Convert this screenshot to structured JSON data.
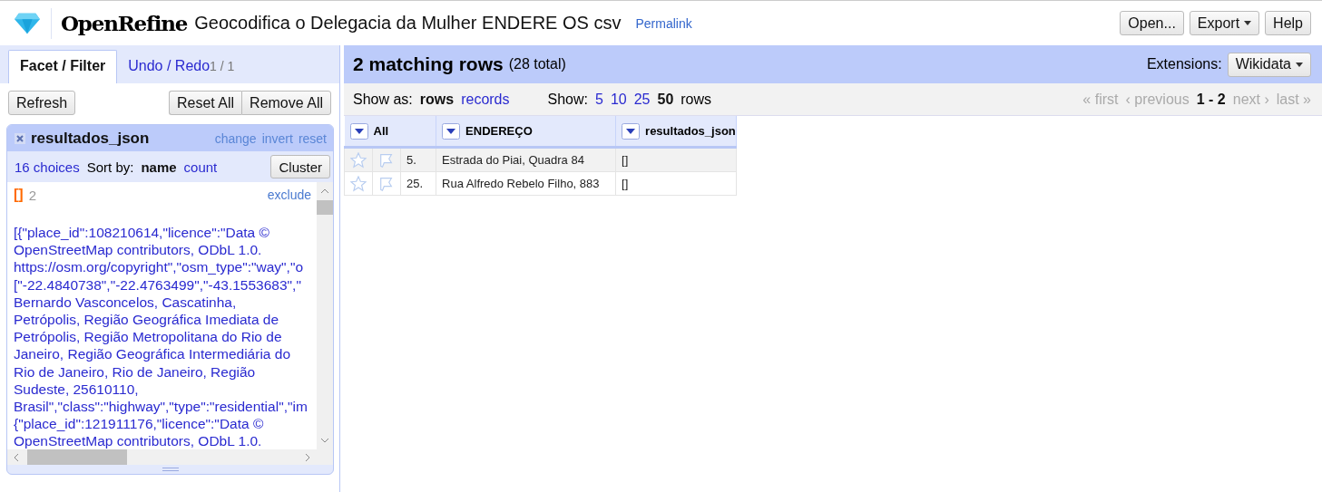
{
  "app": {
    "name": "OpenRefine",
    "project_title": "Geocodifica o Delegacia da Mulher ENDERE OS csv",
    "permalink": "Permalink"
  },
  "header_buttons": [
    {
      "label": "Open...",
      "dropdown": false
    },
    {
      "label": "Export",
      "dropdown": true
    },
    {
      "label": "Help",
      "dropdown": false
    }
  ],
  "left_tabs": [
    {
      "label": "Facet / Filter",
      "selected": true
    },
    {
      "label": "Undo / Redo",
      "count": "1 / 1",
      "selected": false
    }
  ],
  "facet_toolbar": {
    "refresh": "Refresh",
    "reset_all": "Reset All",
    "remove_all": "Remove All"
  },
  "facet": {
    "title": "resultados_json",
    "links": [
      "change",
      "invert",
      "reset"
    ],
    "choices_count": "16 choices",
    "sort_label": "Sort by:",
    "sort_options": [
      {
        "label": "name",
        "selected": true
      },
      {
        "label": "count",
        "selected": false
      }
    ],
    "cluster": "Cluster",
    "choices": [
      {
        "label": "[]",
        "count": "2",
        "selected": true,
        "action": "exclude"
      },
      {
        "selected": false,
        "lines": [
          "[{\"place_id\":108210614,\"licence\":\"Data ©",
          "OpenStreetMap contributors, ODbL 1.0.",
          "https://osm.org/copyright\",\"osm_type\":\"way\",\"o",
          "[\"-22.4840738\",\"-22.4763499\",\"-43.1553683\",\"",
          "Bernardo Vasconcelos, Cascatinha,",
          "Petrópolis, Região Geográfica Imediata de",
          "Petrópolis, Região Metropolitana do Rio de",
          "Janeiro, Região Geográfica Intermediária do",
          "Rio de Janeiro, Rio de Janeiro, Região",
          "Sudeste, 25610110,",
          "Brasil\",\"class\":\"highway\",\"type\":\"residential\",\"im",
          "{\"place_id\":121911176,\"licence\":\"Data ©",
          "OpenStreetMap contributors, ODbL 1.0."
        ]
      }
    ]
  },
  "summary": {
    "matching": "2 matching rows",
    "total": "(28 total)",
    "extensions_label": "Extensions:",
    "extensions_button": "Wikidata"
  },
  "view_bar": {
    "show_as_label": "Show as:",
    "show_as": [
      {
        "label": "rows",
        "selected": true
      },
      {
        "label": "records",
        "selected": false
      }
    ],
    "show_label": "Show:",
    "page_sizes": [
      {
        "label": "5",
        "selected": false
      },
      {
        "label": "10",
        "selected": false
      },
      {
        "label": "25",
        "selected": false
      },
      {
        "label": "50",
        "selected": true
      }
    ],
    "rows_label": "rows",
    "pager": {
      "first": "« first",
      "previous": "‹ previous",
      "range": "1 - 2",
      "next": "next ›",
      "last": "last »"
    }
  },
  "table": {
    "columns": [
      "All",
      "ENDEREÇO",
      "resultados_json"
    ],
    "rows": [
      {
        "starred": false,
        "flagged": false,
        "cells": [
          "5.",
          "Estrada do Piai, Quadra 84",
          "[]"
        ]
      },
      {
        "starred": false,
        "flagged": false,
        "cells": [
          "25.",
          "Rua Alfredo Rebelo Filho, 883",
          "[]"
        ]
      }
    ]
  }
}
